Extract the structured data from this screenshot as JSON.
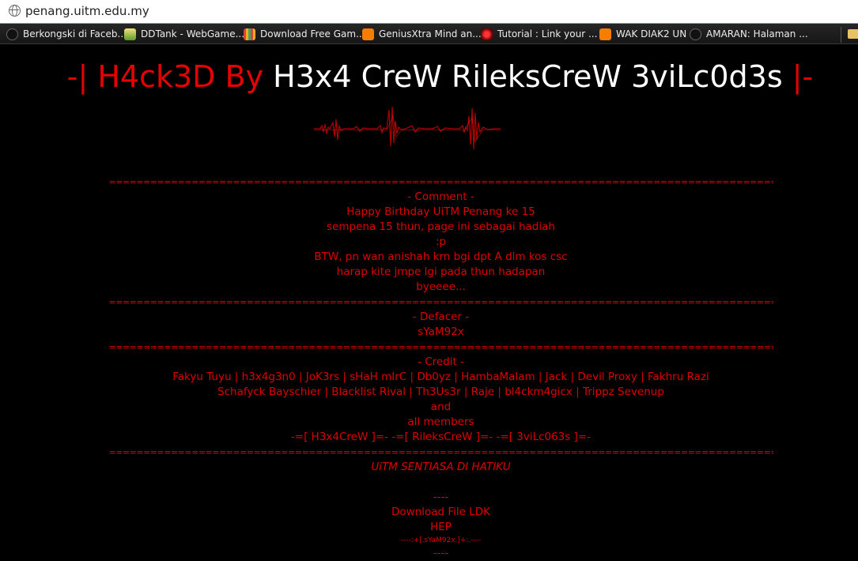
{
  "browser": {
    "url": "penang.uitm.edu.my",
    "bookmarks": [
      {
        "label": "Berkongski di Faceb...",
        "icon": "globe-icon"
      },
      {
        "label": "DDTank - WebGame...",
        "icon": "ddtank-icon"
      },
      {
        "label": "Download Free Gam...",
        "icon": "download-game-icon"
      },
      {
        "label": "GeniusXtra Mind an...",
        "icon": "blogger-icon"
      },
      {
        "label": "Tutorial : Link your ...",
        "icon": "tutorial-icon"
      },
      {
        "label": "WAK DIAK2 UN",
        "icon": "blogger-icon"
      },
      {
        "label": "AMARAN: Halaman ...",
        "icon": "globe-icon"
      }
    ]
  },
  "page": {
    "title_red_left": "-| H4ck3D By",
    "title_white": "H3x4 CreW RileksCreW 3viLc0d3s",
    "title_red_right": "|-",
    "separator": "======================================================================================================================================================",
    "comment": {
      "heading": "- Comment -",
      "lines": [
        "Happy Birthday UiTM Penang ke 15",
        "sempena 15 thun, page ini sebagai hadiah",
        ":p",
        "BTW, pn wan anishah krn bgi dpt A dlm kos csc",
        "harap kite jmpe lgi pada thun hadapan",
        "byeeee..."
      ]
    },
    "defacer": {
      "heading": "- Defacer -",
      "name": "sYaM92x"
    },
    "credit": {
      "heading": "- Credit -",
      "lines": [
        "Fakyu Tuyu | h3x4g3n0 | JoK3rs | sHaH mIrC | Db0yz | HambaMalam | Jack | Devil Proxy | Fakhru Razi",
        "Schafyck Bayschier | Blacklist Rival | Th3Us3r | Raje | bl4ckm4gicx | Trippz Sevenup",
        "and",
        "all members",
        "-=[ H3x4CreW ]=- -=[ RileksCreW ]=- -=[ 3viLc063s ]=-"
      ]
    },
    "footer": {
      "motto": "UiTM SENTIASA DI HATIKU",
      "dashes": "----",
      "download_link": "Download File LDK",
      "hep_link": "HEP",
      "signature": "----:+[.sYaM92x.]+:.----",
      "dashes_bottom": "----"
    }
  },
  "colors": {
    "accent_red": "#e00000",
    "background": "#000000",
    "title_white": "#ffffff"
  }
}
